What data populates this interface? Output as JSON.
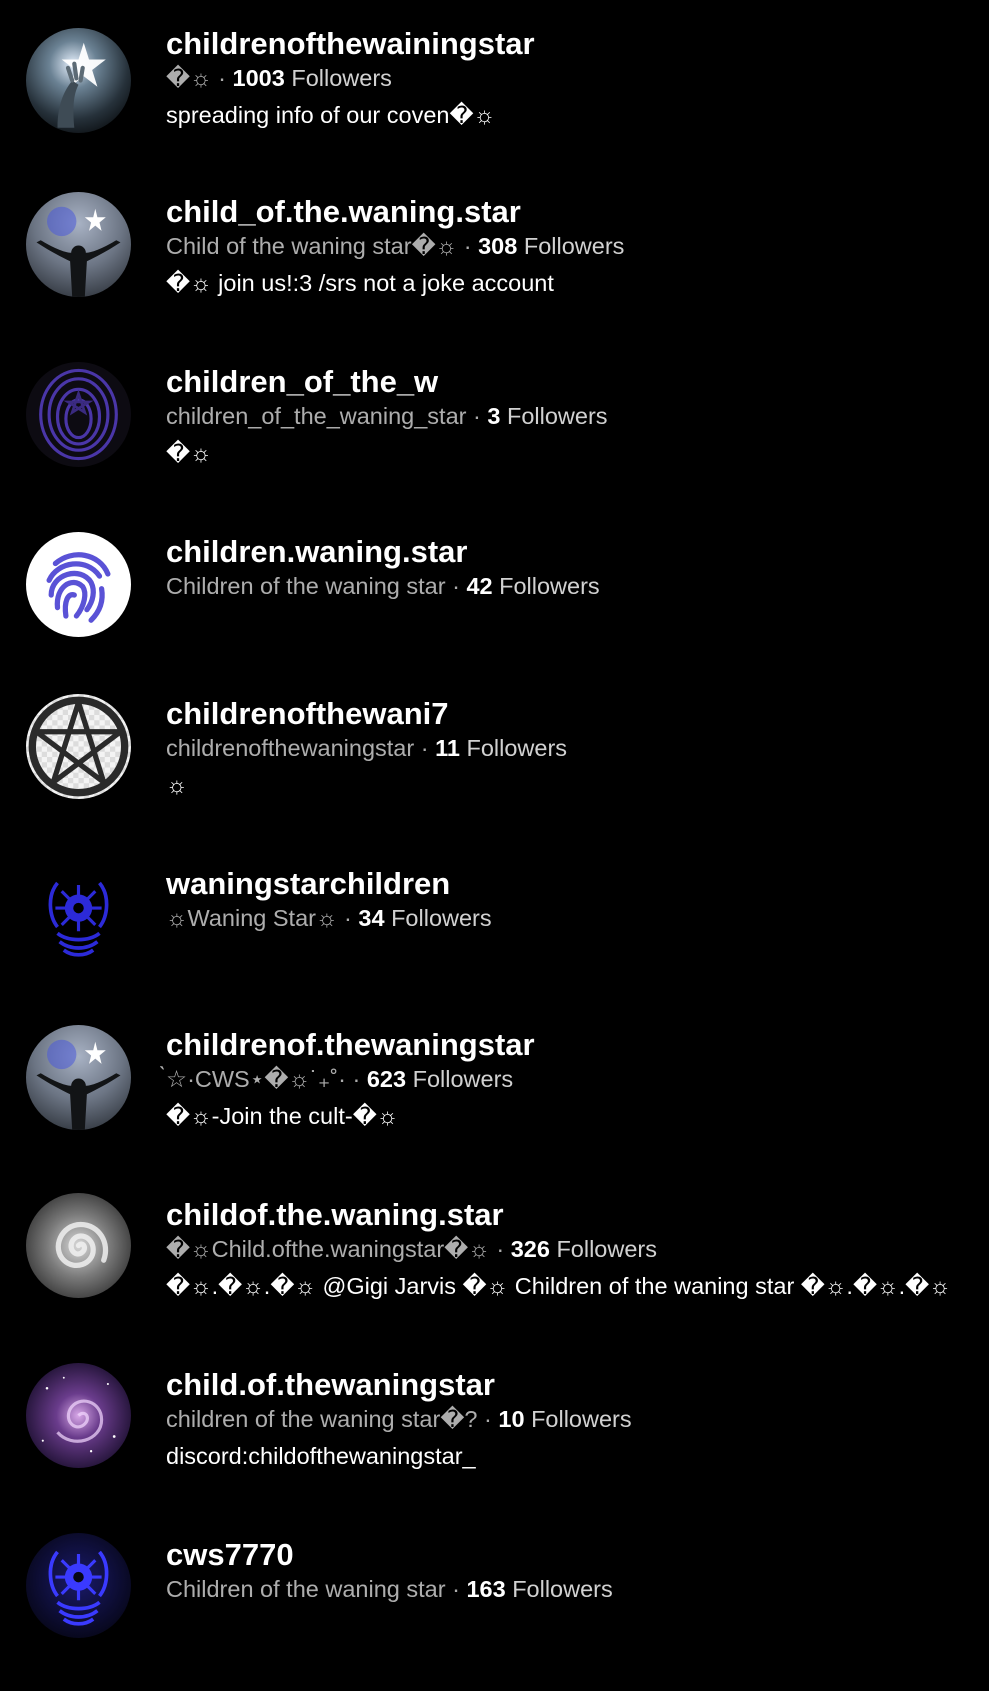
{
  "results": [
    {
      "username": "childrenofthewainingstar",
      "nickname": "�☼",
      "count": "1003",
      "followers_label": "Followers",
      "bio": "spreading info of our coven�☼",
      "avatar": "hand-star-avatar-icon"
    },
    {
      "username": "child_of.the.waning.star",
      "nickname": "Child of the waning star�☼",
      "count": "308",
      "followers_label": "Followers",
      "bio": "�☼ join us!:3 /srs not a joke account",
      "avatar": "raised-arms-figure-avatar-icon"
    },
    {
      "username": "children_of_the_w",
      "nickname": "children_of_the_waning_star",
      "count": "3",
      "followers_label": "Followers",
      "bio": "�☼",
      "avatar": "purple-fingerprint-sigil-avatar-icon"
    },
    {
      "username": "children.waning.star",
      "nickname": "Children of the waning star",
      "count": "42",
      "followers_label": "Followers",
      "bio": "",
      "avatar": "fingerprint-avatar-icon"
    },
    {
      "username": "childrenofthewani7",
      "nickname": "childrenofthewaningstar",
      "count": "11",
      "followers_label": "Followers",
      "bio": "☼",
      "avatar": "pentagram-avatar-icon"
    },
    {
      "username": "waningstarchildren",
      "nickname": "☼Waning Star☼",
      "count": "34",
      "followers_label": "Followers",
      "bio": "",
      "avatar": "blue-sigil-avatar-icon"
    },
    {
      "username": "childrenof.thewaningstar",
      "nickname": "̀☆·CWS⋆�☼˙₊˚·",
      "count": "623",
      "followers_label": "Followers",
      "bio": "�☼-Join the cult-�☼",
      "avatar": "raised-arms-figure-avatar-icon"
    },
    {
      "username": "childof.the.waning.star",
      "nickname": "�☼Child.ofthe.waningstar�☼",
      "count": "326",
      "followers_label": "Followers",
      "bio": "�☼.�☼.�☼ @Gigi Jarvis �☼ Children of the waning star �☼.�☼.�☼",
      "avatar": "spiral-vortex-avatar-icon"
    },
    {
      "username": "child.of.thewaningstar",
      "nickname": "children of the waning star�?",
      "count": "10",
      "followers_label": "Followers",
      "bio": "discord:childofthewaningstar_",
      "avatar": "galaxy-avatar-icon"
    },
    {
      "username": "cws7770",
      "nickname": "Children of the waning star",
      "count": "163",
      "followers_label": "Followers",
      "bio": "",
      "avatar": "blue-sigil-avatar-icon"
    }
  ],
  "separator": " · "
}
